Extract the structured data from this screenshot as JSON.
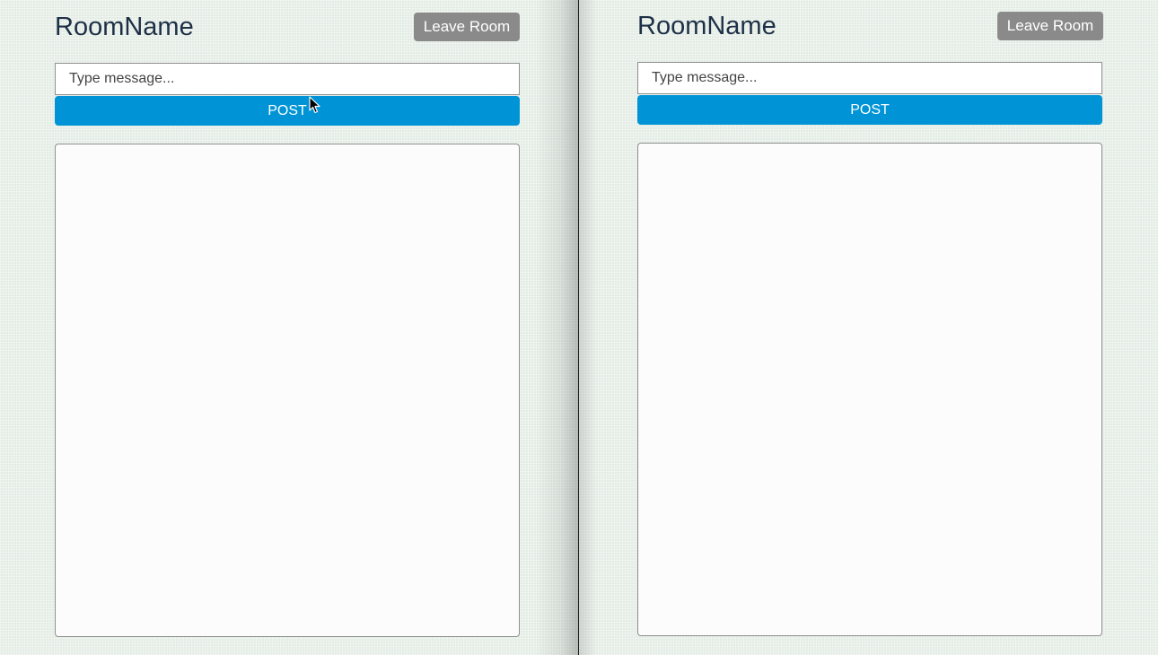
{
  "left_window": {
    "room_name": "RoomName",
    "leave_label": "Leave Room",
    "message_placeholder": "Type message...",
    "post_label": "POST"
  },
  "right_window": {
    "room_name": "RoomName",
    "leave_label": "Leave Room",
    "message_placeholder": "Type message...",
    "post_label": "POST"
  },
  "colors": {
    "post_button": "#0094d7",
    "leave_button": "#8a8a8a",
    "title_text": "#1e3048",
    "background": "#e3ece4"
  },
  "icons": {
    "cursor": "mouse-pointer-icon"
  }
}
